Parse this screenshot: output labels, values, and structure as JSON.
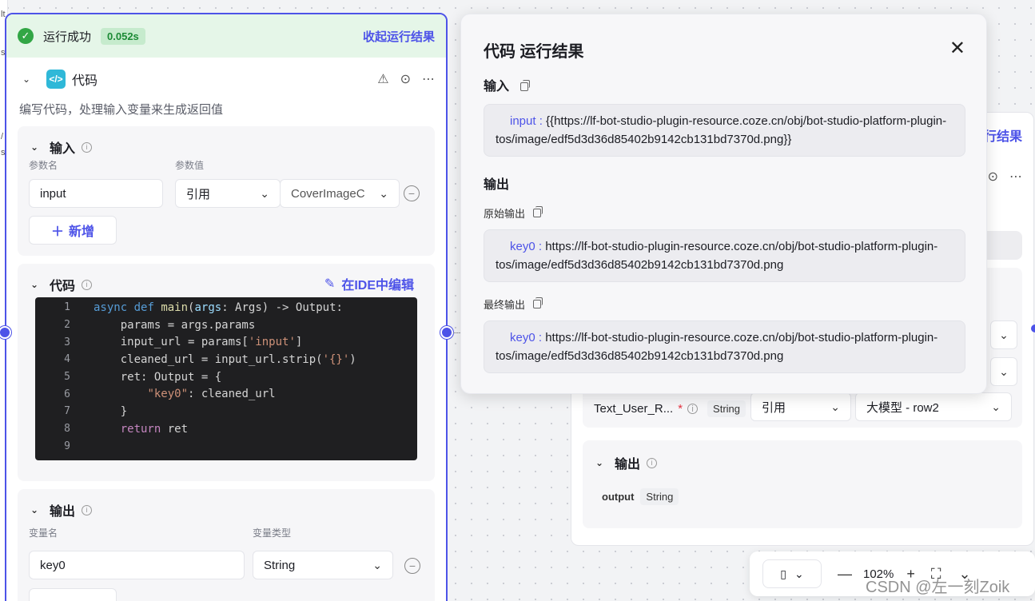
{
  "run_status": {
    "label": "运行成功",
    "time": "0.052s",
    "collapse_label": "收起运行结果"
  },
  "node": {
    "title": "代码",
    "description": "编写代码，处理输入变量来生成返回值",
    "input_section": {
      "title": "输入",
      "col_name": "参数名",
      "col_value": "参数值",
      "rows": [
        {
          "name": "input",
          "type": "引用",
          "value": "CoverImageC"
        }
      ],
      "add_label": "新增"
    },
    "code_section": {
      "title": "代码",
      "edit_label": "在IDE中编辑",
      "line_numbers": [
        "1",
        "2",
        "3",
        "4",
        "5",
        "6",
        "7",
        "8",
        "9"
      ],
      "code_lines": [
        "async def main(args: Args) -> Output:",
        "    params = args.params",
        "    input_url = params['input']",
        "    cleaned_url = input_url.strip('{}')",
        "    ret: Output = {",
        "        \"key0\": cleaned_url",
        "    }",
        "    return ret",
        ""
      ]
    },
    "output_section": {
      "title": "输出",
      "col_name": "变量名",
      "col_type": "变量类型",
      "rows": [
        {
          "name": "key0",
          "type": "String"
        }
      ]
    }
  },
  "result_panel": {
    "title": "代码 运行结果",
    "input_label": "输入",
    "input_key": "input :",
    "input_value": "{{https://lf-bot-studio-plugin-resource.coze.cn/obj/bot-studio-platform-plugin-tos/image/edf5d3d36d85402b9142cb131bd7370d.png}}",
    "output_label": "输出",
    "raw_output_label": "原始输出",
    "raw_key": "key0 :",
    "raw_value": "https://lf-bot-studio-plugin-resource.coze.cn/obj/bot-studio-platform-plugin-tos/image/edf5d3d36d85402b9142cb131bd7370d.png",
    "final_output_label": "最终输出",
    "final_key": "key0 :",
    "final_value": "https://lf-bot-studio-plugin-resource.coze.cn/obj/bot-studio-platform-plugin-tos/image/edf5d3d36d85402b9142cb131bd7370d.png"
  },
  "bg_node": {
    "collapse_label_partial": "行结果",
    "param_name": "Text_User_R...",
    "required_mark": "*",
    "param_type": "String",
    "ref_label": "引用",
    "ref_value": "大模型 - row2",
    "output_title": "输出",
    "output_name": "output",
    "output_type": "String"
  },
  "zoombar": {
    "zoom": "102%"
  },
  "watermark": "CSDN @左一刻Zoik",
  "colors": {
    "accent": "#4d53e8",
    "success": "#32a645",
    "success_bg": "#e5f6e8"
  }
}
